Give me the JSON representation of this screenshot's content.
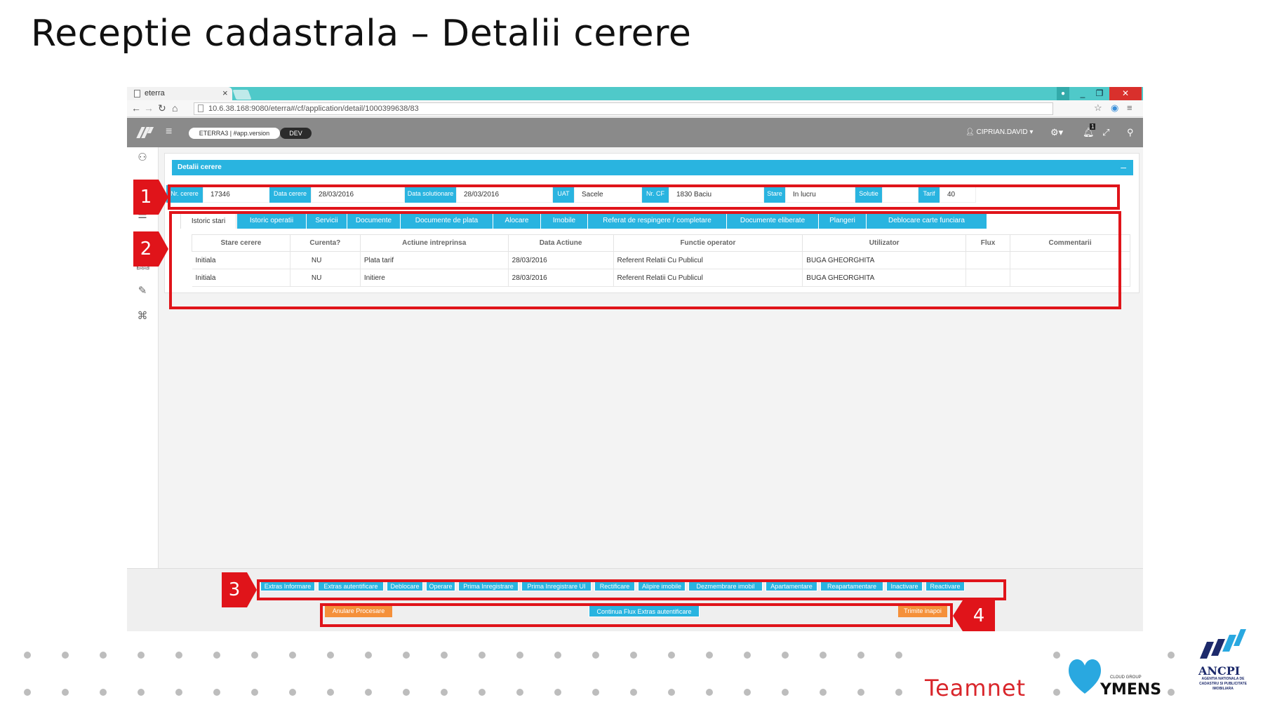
{
  "slide": {
    "title": "Receptie cadastrala – Detalii cerere"
  },
  "browser": {
    "tab_title": "eterra",
    "tab_close": "×",
    "url": "10.6.38.168:9080/eterra#/cf/application/detail/1000399638/83"
  },
  "appbar": {
    "version_pill": "ETERRA3 | #app.version",
    "env_pill": "DEV",
    "user": "CIPRIAN.DAVID",
    "notification_count": "1"
  },
  "panel": {
    "title": "Detalii cerere",
    "collapse": "–"
  },
  "fields": [
    {
      "label": "Nr. cerere",
      "value": "17346"
    },
    {
      "label": "Data cerere",
      "value": "28/03/2016"
    },
    {
      "label": "Data solutionare",
      "value": "28/03/2016"
    },
    {
      "label": "UAT",
      "value": "Sacele"
    },
    {
      "label": "Nr. CF",
      "value": "1830 Baciu"
    },
    {
      "label": "Stare",
      "value": "In lucru"
    },
    {
      "label": "Solutie",
      "value": ""
    },
    {
      "label": "Tarif",
      "value": "40"
    }
  ],
  "tabs": [
    "Istoric stari",
    "Istoric operatii",
    "Servicii",
    "Documente",
    "Documente de plata",
    "Alocare",
    "Imobile",
    "Referat de respingere / completare",
    "Documente eliberate",
    "Plangeri",
    "Deblocare carte funciara"
  ],
  "table": {
    "headers": [
      "Stare cerere",
      "Curenta?",
      "Actiune intreprinsa",
      "Data Actiune",
      "Functie operator",
      "Utilizator",
      "Flux",
      "Commentarii"
    ],
    "rows": [
      [
        "Initiala",
        "NU",
        "Plata tarif",
        "28/03/2016",
        "Referent Relatii Cu Publicul",
        "BUGA GHEORGHITA",
        "",
        ""
      ],
      [
        "Initiala",
        "NU",
        "Initiere",
        "28/03/2016",
        "Referent Relatii Cu Publicul",
        "BUGA GHEORGHITA",
        "",
        ""
      ]
    ]
  },
  "action_buttons": [
    "Extras Informare",
    "Extras autentificare",
    "Deblocare",
    "Operare",
    "Prima Inregistrare",
    "Prima Inregistrare UI",
    "Rectificare",
    "Alipire imobile",
    "Dezmembrare imobil",
    "Apartamentare",
    "Reapartamentare",
    "Inactivare",
    "Reactivare"
  ],
  "flow_buttons": {
    "cancel": "Anulare Procesare",
    "continue": "Continua Flux Extras autentificare",
    "send_back": "Trimite inapoi"
  },
  "annotations": [
    "1",
    "2",
    "3",
    "4"
  ],
  "logos": {
    "teamnet": "Teamnet",
    "ymens": "YMENS",
    "ymens_caption": "CLOUD GROUP",
    "ancpi": "ANCPI",
    "ancpi_sub": "AGENTIA NATIONALA DE CADASTRU SI PUBLICITATE IMOBILIARA"
  },
  "colors": {
    "accent": "#29b4e0",
    "annotation": "#e0141a",
    "orange": "#f5903a",
    "tabbar": "#4fc9c9",
    "teamnet": "#d9262b",
    "ymens": "#29a8e0",
    "ancpi": "#1d2a6b"
  }
}
